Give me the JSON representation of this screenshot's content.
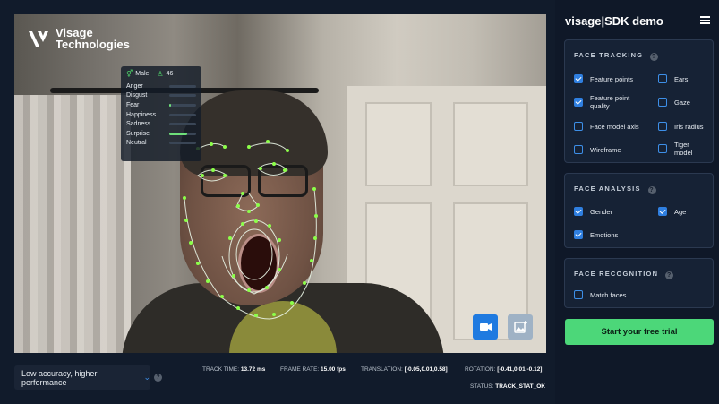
{
  "app": {
    "title": "visage|SDK demo",
    "brand": "Visage Technologies",
    "brand_line1": "Visage",
    "brand_line2": "Technologies"
  },
  "overlay": {
    "gender": "Male",
    "age": "46",
    "emotions": [
      {
        "label": "Anger",
        "level": 0.0
      },
      {
        "label": "Disgust",
        "level": 0.0
      },
      {
        "label": "Fear",
        "level": 0.05
      },
      {
        "label": "Happiness",
        "level": 0.0
      },
      {
        "label": "Sadness",
        "level": 0.0
      },
      {
        "label": "Surprise",
        "level": 0.65
      },
      {
        "label": "Neutral",
        "level": 0.0
      }
    ]
  },
  "status": {
    "accuracy_select": "Low accuracy, higher performance",
    "track_time_label": "TRACK TIME:",
    "track_time": "13.72 ms",
    "frame_rate_label": "FRAME RATE:",
    "frame_rate": "15.00 fps",
    "translation_label": "TRANSLATION:",
    "translation": "[-0.05,0.01,0.58]",
    "rotation_label": "ROTATION:",
    "rotation": "[-0.41,0.01,-0.12]",
    "status_label": "STATUS:",
    "status": "TRACK_STAT_OK"
  },
  "sections": {
    "tracking": {
      "title": "FACE TRACKING",
      "options": [
        {
          "label": "Feature points",
          "checked": true
        },
        {
          "label": "Ears",
          "checked": false
        },
        {
          "label": "Feature point quality",
          "checked": true
        },
        {
          "label": "Gaze",
          "checked": false
        },
        {
          "label": "Face model axis",
          "checked": false
        },
        {
          "label": "Iris radius",
          "checked": false
        },
        {
          "label": "Wireframe",
          "checked": false
        },
        {
          "label": "Tiger model",
          "checked": false
        }
      ]
    },
    "analysis": {
      "title": "FACE ANALYSIS",
      "options": [
        {
          "label": "Gender",
          "checked": true
        },
        {
          "label": "Age",
          "checked": true
        },
        {
          "label": "Emotions",
          "checked": true
        }
      ]
    },
    "recognition": {
      "title": "FACE RECOGNITION",
      "options": [
        {
          "label": "Match faces",
          "checked": false
        }
      ]
    }
  },
  "cta": {
    "label": "Start your free trial"
  },
  "colors": {
    "accent": "#2f7fe0",
    "cta": "#4cd779",
    "mesh": "#8cff4a"
  },
  "icons": {
    "menu": "hamburger-icon",
    "camera": "video-camera-icon",
    "snapshot": "image-add-icon",
    "help": "help-icon"
  }
}
